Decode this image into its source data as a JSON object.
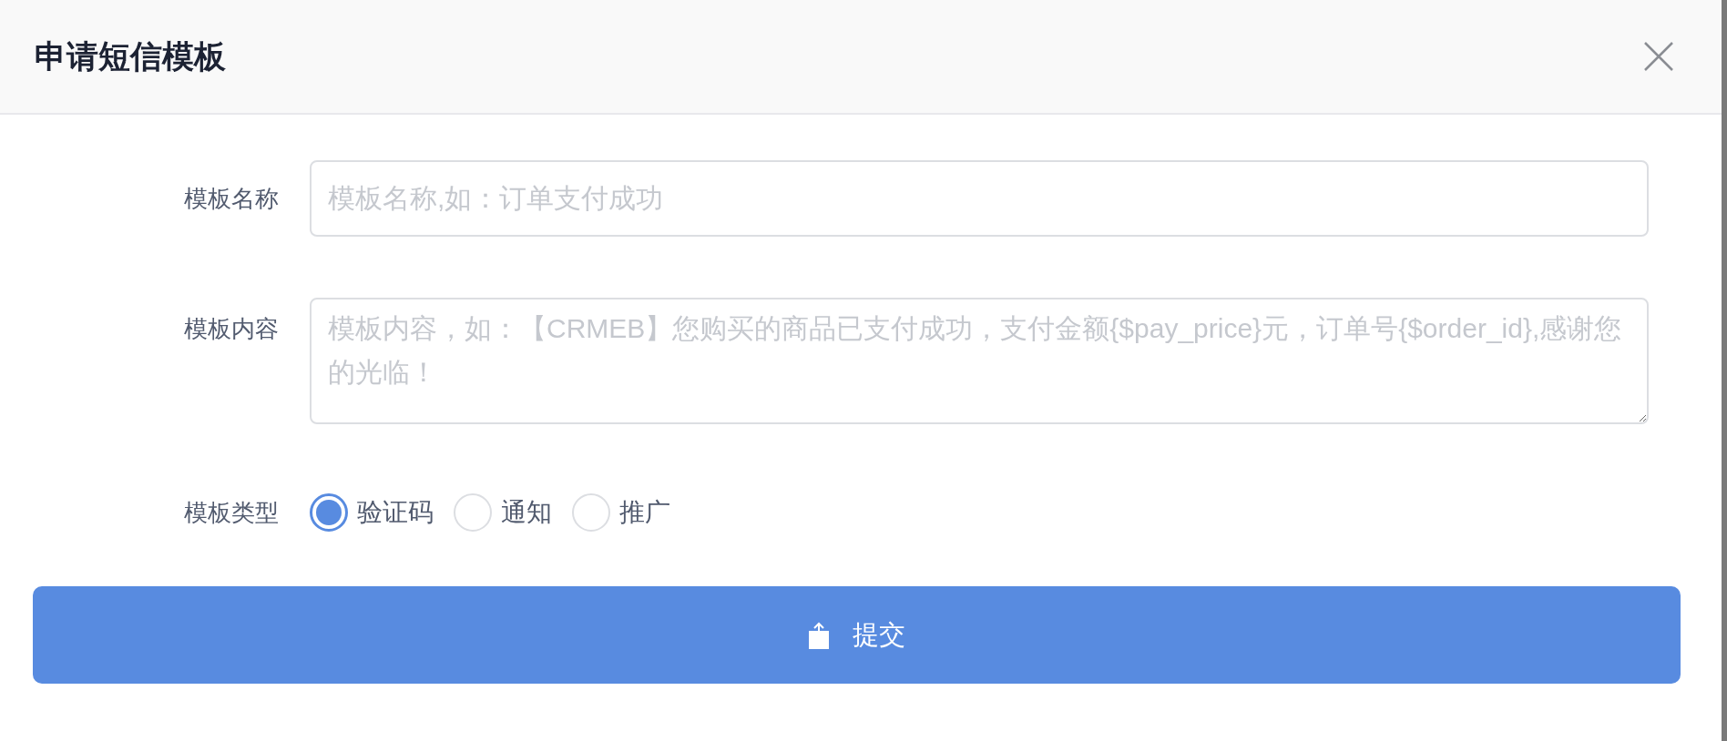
{
  "dialog": {
    "title": "申请短信模板"
  },
  "fields": [
    {
      "kind": "input",
      "label": "模板名称",
      "placeholder": "模板名称,如：订单支付成功"
    },
    {
      "kind": "textarea",
      "label": "模板内容",
      "placeholder": "模板内容，如：【CRMEB】您购买的商品已支付成功，支付金额{$pay_price}元，订单号{$order_id},感谢您的光临！"
    },
    {
      "kind": "radio",
      "label": "模板类型",
      "options": [
        {
          "label": "验证码",
          "selected": true
        },
        {
          "label": "通知",
          "selected": false
        },
        {
          "label": "推广",
          "selected": false
        }
      ]
    }
  ],
  "submit_button": {
    "label": "提交"
  }
}
